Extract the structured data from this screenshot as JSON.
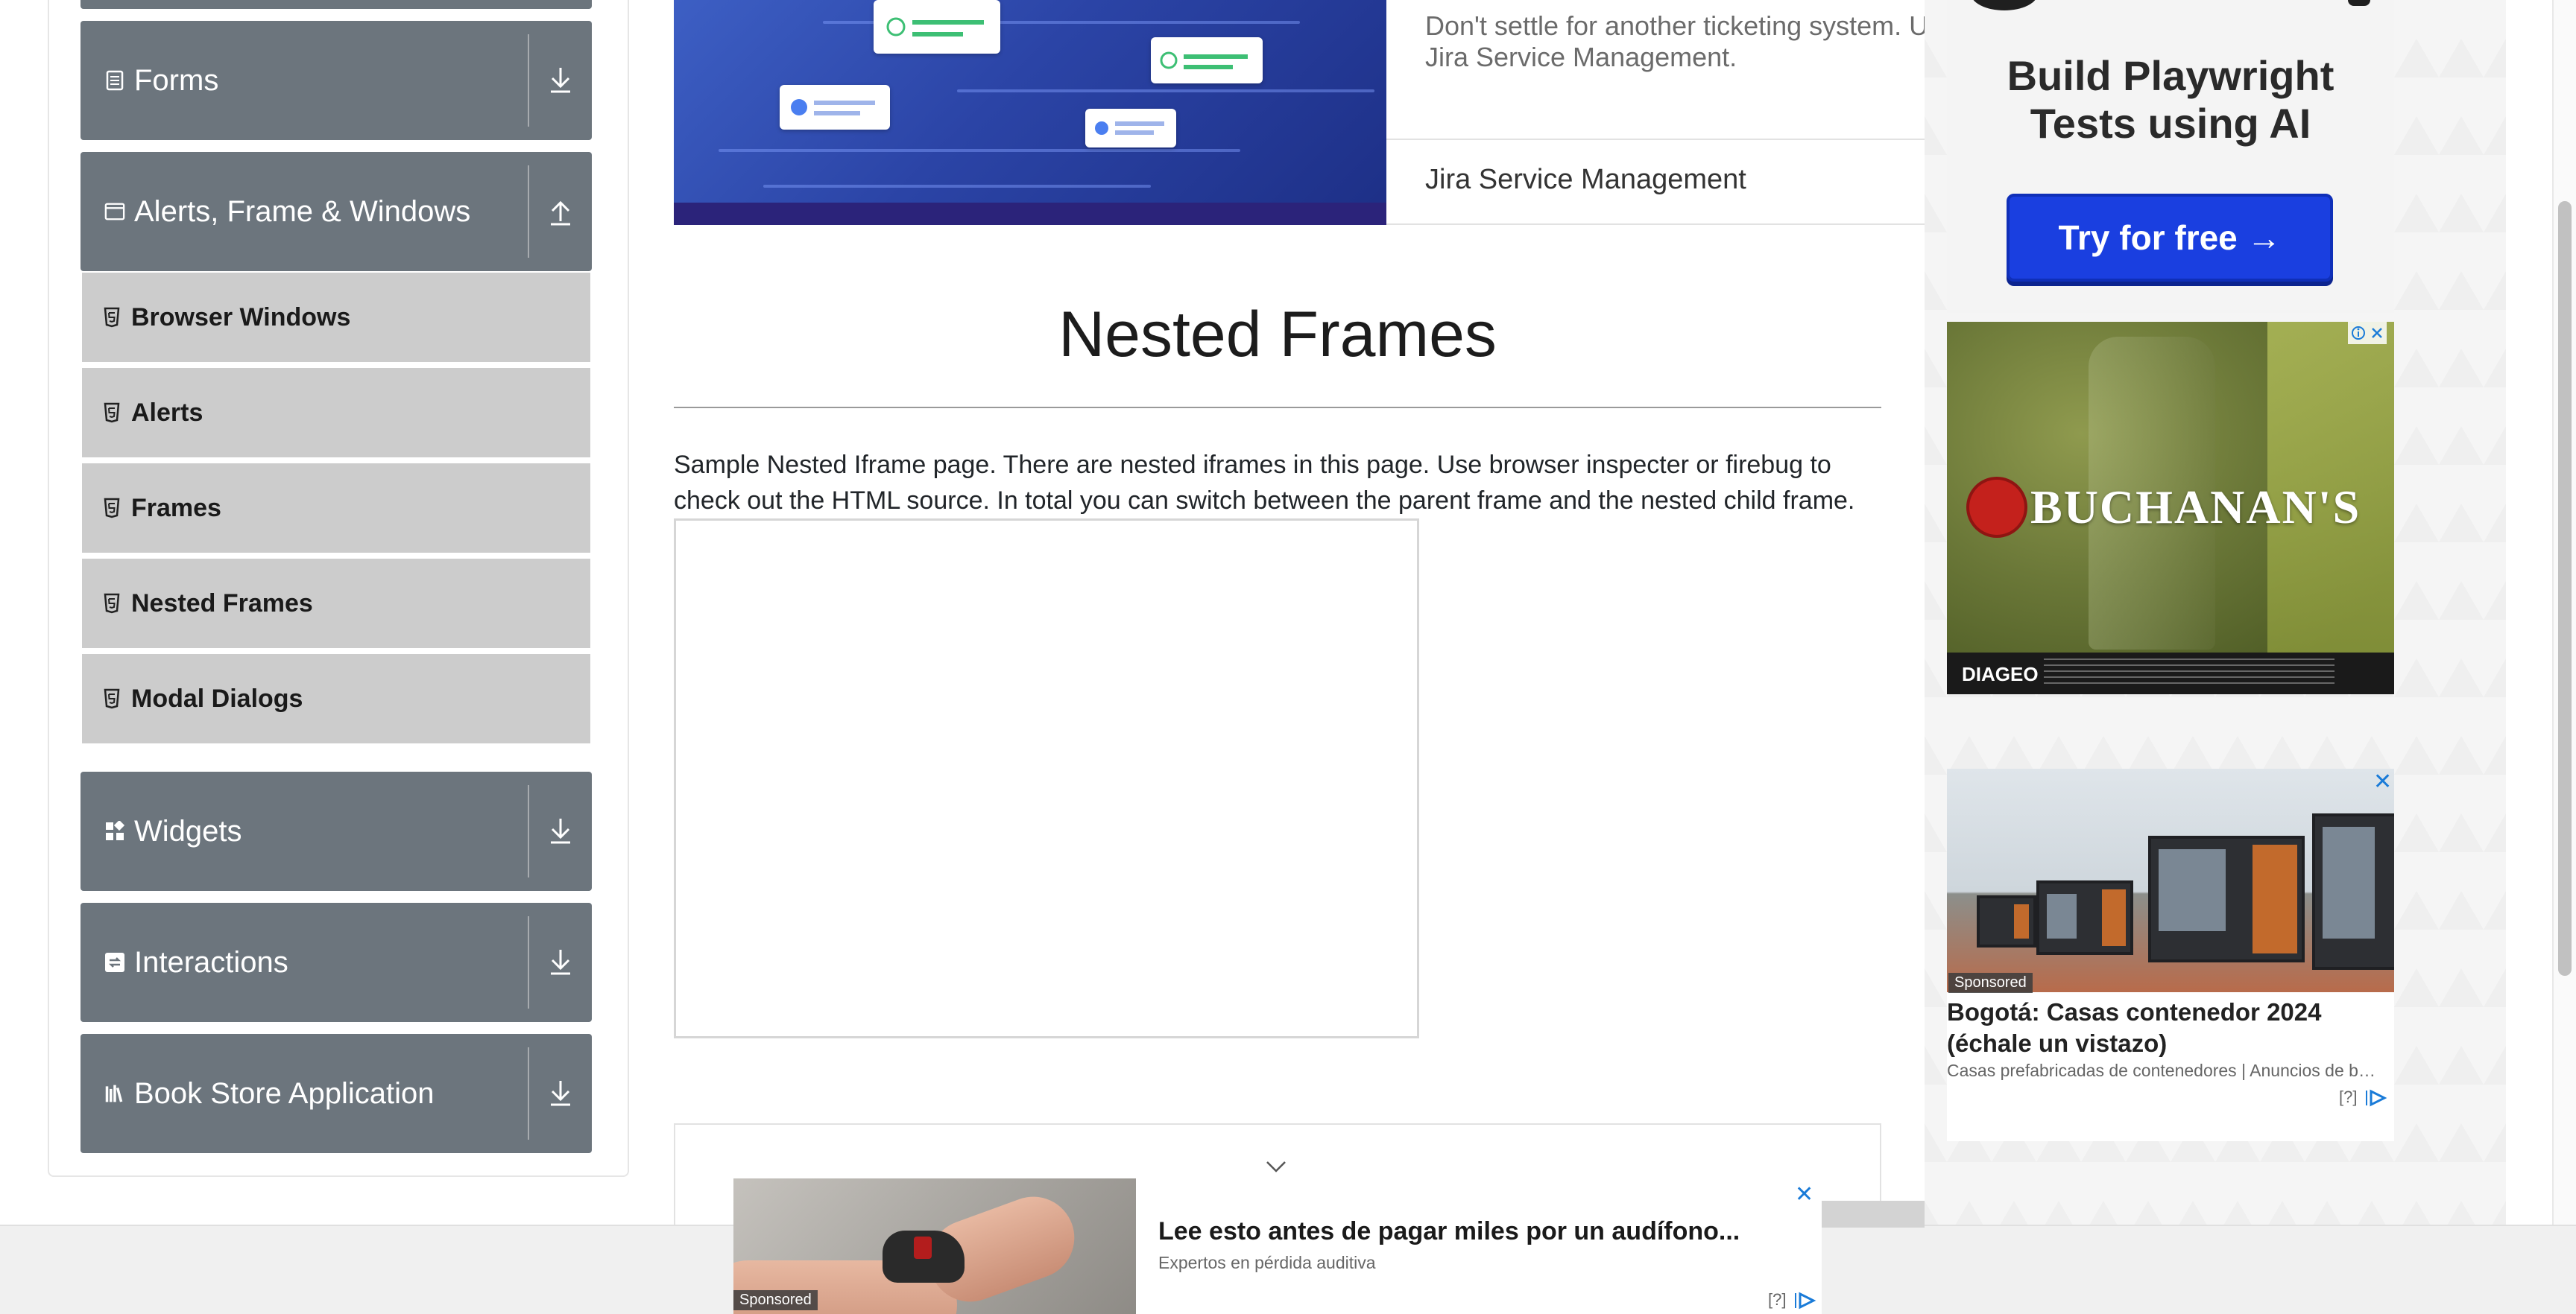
{
  "sidebar": {
    "groups": [
      {
        "label": "Forms",
        "icon": "form-icon",
        "state": "collapsed"
      },
      {
        "label": "Alerts, Frame & Windows",
        "icon": "window-icon",
        "state": "expanded"
      },
      {
        "label": "Widgets",
        "icon": "widgets-icon",
        "state": "collapsed"
      },
      {
        "label": "Interactions",
        "icon": "interactions-icon",
        "state": "collapsed"
      },
      {
        "label": "Book Store Application",
        "icon": "books-icon",
        "state": "collapsed"
      }
    ],
    "items": [
      {
        "label": "Browser Windows"
      },
      {
        "label": "Alerts"
      },
      {
        "label": "Frames"
      },
      {
        "label": "Nested Frames"
      },
      {
        "label": "Modal Dialogs"
      }
    ]
  },
  "promo": {
    "text_line1": "Don't settle for another ticketing system. U",
    "text_line2": "Jira Service Management.",
    "brand": "Jira Service Management"
  },
  "main": {
    "title": "Nested Frames",
    "description": "Sample Nested Iframe page. There are nested iframes in this page. Use browser inspecter or firebug to check out the HTML source. In total you can switch between the parent frame and the nested child frame."
  },
  "ads": {
    "right_top": {
      "headline_line1": "Build Playwright",
      "headline_line2": "Tests using AI",
      "button": "Try for free →"
    },
    "right_middle": {
      "brand": "BUCHANAN'S",
      "maker": "DIAGEO"
    },
    "right_bottom": {
      "sponsored": "Sponsored",
      "title": "Bogotá: Casas contenedor 2024 (échale un vistazo)",
      "subtitle": "Casas prefabricadas de contenedores | Anuncios de b…",
      "footer": "[?]"
    },
    "bottom": {
      "sponsored": "Sponsored",
      "title": "Lee esto antes de pagar miles por un audífono...",
      "subtitle": "Expertos en pérdida auditiva",
      "footer": "[?]"
    }
  },
  "colors": {
    "sidebar_header": "#6c757d",
    "sidebar_item": "#cccccc",
    "ad_button": "#1a3fe0",
    "ad_choices": "#1a7bd8"
  }
}
